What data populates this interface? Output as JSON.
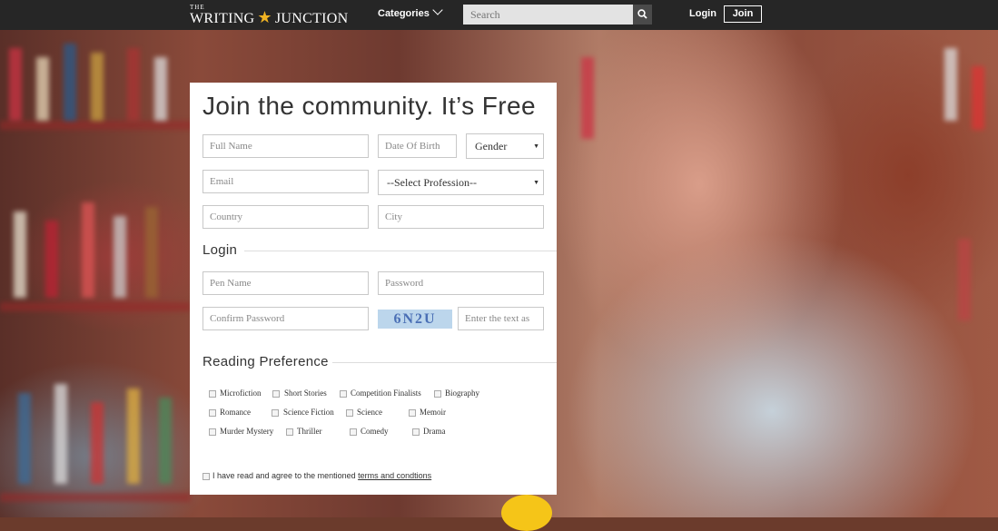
{
  "header": {
    "logo_small": "THE",
    "logo_left": "WRITING",
    "logo_right": "JUNCTION",
    "categories_label": "Categories",
    "search_placeholder": "Search",
    "login_label": "Login",
    "join_label": "Join"
  },
  "form": {
    "title": "Join the community. It’s Free",
    "full_name_placeholder": "Full Name",
    "dob_placeholder": "Date Of Birth",
    "gender_value": "Gender",
    "email_placeholder": "Email",
    "profession_value": "--Select Profession--",
    "country_placeholder": "Country",
    "city_placeholder": "City",
    "login_heading": "Login",
    "pen_name_placeholder": "Pen Name",
    "password_placeholder": "Password",
    "confirm_password_placeholder": "Confirm Password",
    "captcha_text": "6N2U",
    "captcha_input_placeholder": "Enter the text as",
    "reading_heading": "Reading Preference",
    "preferences": [
      "Microfiction",
      "Short Stories",
      "Competition Finalists",
      "Biography",
      "Romance",
      "Science Fiction",
      "Science",
      "Memoir",
      "Murder Mystery",
      "Thriller",
      "Comedy",
      "Drama"
    ],
    "terms_text": "I have read and agree to the mentioned",
    "terms_link": "terms and condtions"
  },
  "colors": {
    "topbar": "#262626",
    "accent": "#f0b323"
  }
}
